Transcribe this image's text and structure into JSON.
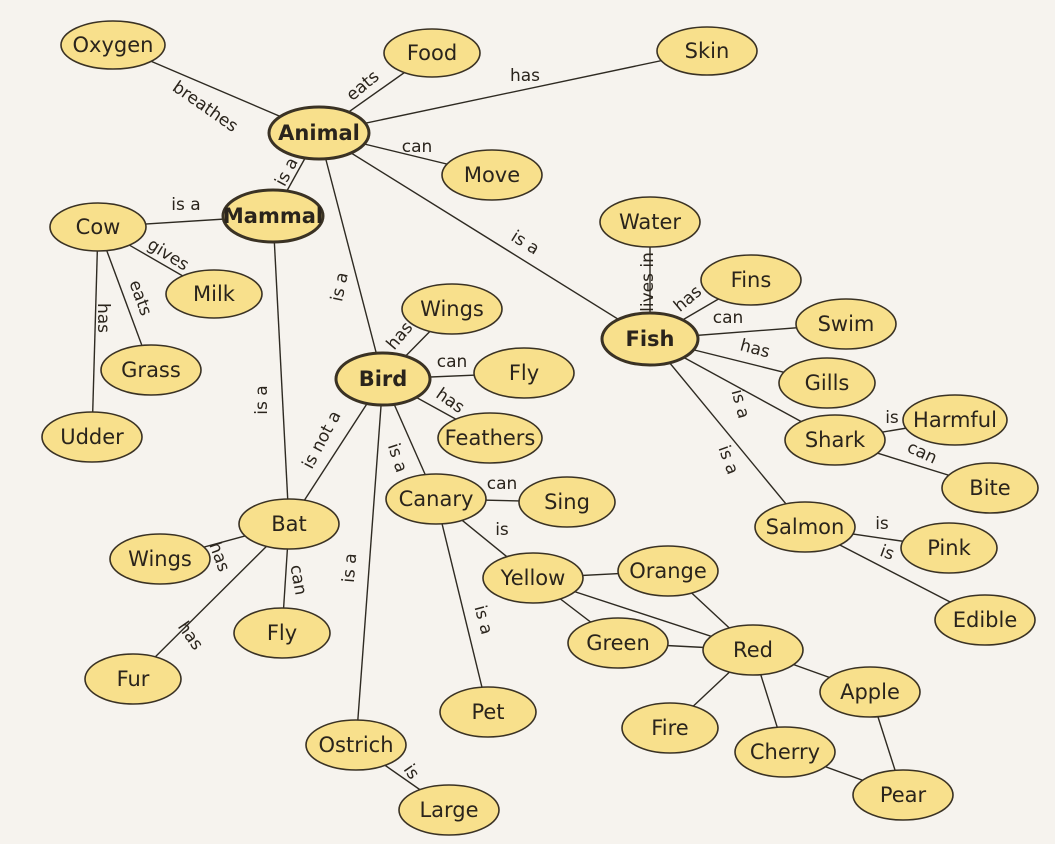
{
  "colors": {
    "node_fill": "#f8e08c",
    "node_stroke": "#3a3224",
    "line": "#2e2a22",
    "background": "#f6f3ee"
  },
  "nodes": [
    {
      "id": "oxygen",
      "label": "Oxygen"
    },
    {
      "id": "food",
      "label": "Food"
    },
    {
      "id": "skin",
      "label": "Skin"
    },
    {
      "id": "animal",
      "label": "Animal",
      "bold": true
    },
    {
      "id": "move",
      "label": "Move"
    },
    {
      "id": "mammal",
      "label": "Mammal",
      "bold": true
    },
    {
      "id": "cow",
      "label": "Cow"
    },
    {
      "id": "milk",
      "label": "Milk"
    },
    {
      "id": "grass",
      "label": "Grass"
    },
    {
      "id": "udder",
      "label": "Udder"
    },
    {
      "id": "water",
      "label": "Water"
    },
    {
      "id": "fins",
      "label": "Fins"
    },
    {
      "id": "swim",
      "label": "Swim"
    },
    {
      "id": "fish",
      "label": "Fish",
      "bold": true
    },
    {
      "id": "gills",
      "label": "Gills"
    },
    {
      "id": "wings",
      "label": "Wings"
    },
    {
      "id": "fly",
      "label": "Fly"
    },
    {
      "id": "bird",
      "label": "Bird",
      "bold": true
    },
    {
      "id": "feathers",
      "label": "Feathers"
    },
    {
      "id": "harmful",
      "label": "Harmful"
    },
    {
      "id": "shark",
      "label": "Shark"
    },
    {
      "id": "bite",
      "label": "Bite"
    },
    {
      "id": "canary",
      "label": "Canary"
    },
    {
      "id": "sing",
      "label": "Sing"
    },
    {
      "id": "bat",
      "label": "Bat"
    },
    {
      "id": "salmon",
      "label": "Salmon"
    },
    {
      "id": "pink",
      "label": "Pink"
    },
    {
      "id": "wings2",
      "label": "Wings"
    },
    {
      "id": "yellow",
      "label": "Yellow"
    },
    {
      "id": "orange",
      "label": "Orange"
    },
    {
      "id": "fly2",
      "label": "Fly"
    },
    {
      "id": "green",
      "label": "Green"
    },
    {
      "id": "red",
      "label": "Red"
    },
    {
      "id": "edible",
      "label": "Edible"
    },
    {
      "id": "fur",
      "label": "Fur"
    },
    {
      "id": "apple",
      "label": "Apple"
    },
    {
      "id": "pet",
      "label": "Pet"
    },
    {
      "id": "fire",
      "label": "Fire"
    },
    {
      "id": "cherry",
      "label": "Cherry"
    },
    {
      "id": "ostrich",
      "label": "Ostrich"
    },
    {
      "id": "pear",
      "label": "Pear"
    },
    {
      "id": "large",
      "label": "Large"
    }
  ],
  "edges": [
    {
      "from": "animal",
      "to": "oxygen",
      "label": "breathes"
    },
    {
      "from": "animal",
      "to": "food",
      "label": "eats"
    },
    {
      "from": "animal",
      "to": "skin",
      "label": "has"
    },
    {
      "from": "animal",
      "to": "move",
      "label": "can"
    },
    {
      "from": "animal",
      "to": "mammal",
      "label": "is a"
    },
    {
      "from": "animal",
      "to": "bird",
      "label": "is a"
    },
    {
      "from": "animal",
      "to": "fish",
      "label": "is a"
    },
    {
      "from": "mammal",
      "to": "cow",
      "label": "is a"
    },
    {
      "from": "cow",
      "to": "milk",
      "label": "gives"
    },
    {
      "from": "cow",
      "to": "grass",
      "label": "eats"
    },
    {
      "from": "cow",
      "to": "udder",
      "label": "has"
    },
    {
      "from": "mammal",
      "to": "bat",
      "label": "is a"
    },
    {
      "from": "bird",
      "to": "bat",
      "label": "is not a"
    },
    {
      "from": "bird",
      "to": "wings",
      "label": "has"
    },
    {
      "from": "bird",
      "to": "fly",
      "label": "can"
    },
    {
      "from": "bird",
      "to": "feathers",
      "label": "has"
    },
    {
      "from": "bird",
      "to": "canary",
      "label": "is a"
    },
    {
      "from": "bird",
      "to": "ostrich",
      "label": "is a"
    },
    {
      "from": "bat",
      "to": "wings2",
      "label": "has"
    },
    {
      "from": "bat",
      "to": "fly2",
      "label": "can"
    },
    {
      "from": "bat",
      "to": "fur",
      "label": "has"
    },
    {
      "from": "canary",
      "to": "sing",
      "label": "can"
    },
    {
      "from": "canary",
      "to": "yellow",
      "label": "is"
    },
    {
      "from": "canary",
      "to": "pet",
      "label": "is a"
    },
    {
      "from": "ostrich",
      "to": "large",
      "label": "is"
    },
    {
      "from": "fish",
      "to": "water",
      "label": "lives in"
    },
    {
      "from": "fish",
      "to": "fins",
      "label": "has"
    },
    {
      "from": "fish",
      "to": "swim",
      "label": "can"
    },
    {
      "from": "fish",
      "to": "gills",
      "label": "has"
    },
    {
      "from": "fish",
      "to": "shark",
      "label": "is a"
    },
    {
      "from": "fish",
      "to": "salmon",
      "label": "is a"
    },
    {
      "from": "shark",
      "to": "harmful",
      "label": "is"
    },
    {
      "from": "shark",
      "to": "bite",
      "label": "can"
    },
    {
      "from": "salmon",
      "to": "pink",
      "label": "is"
    },
    {
      "from": "salmon",
      "to": "edible",
      "label": "is"
    },
    {
      "from": "yellow",
      "to": "orange",
      "label": ""
    },
    {
      "from": "yellow",
      "to": "red",
      "label": ""
    },
    {
      "from": "yellow",
      "to": "green",
      "label": ""
    },
    {
      "from": "green",
      "to": "red",
      "label": ""
    },
    {
      "from": "orange",
      "to": "red",
      "label": ""
    },
    {
      "from": "red",
      "to": "fire",
      "label": ""
    },
    {
      "from": "red",
      "to": "apple",
      "label": ""
    },
    {
      "from": "red",
      "to": "cherry",
      "label": ""
    },
    {
      "from": "apple",
      "to": "pear",
      "label": ""
    },
    {
      "from": "cherry",
      "to": "pear",
      "label": ""
    }
  ]
}
